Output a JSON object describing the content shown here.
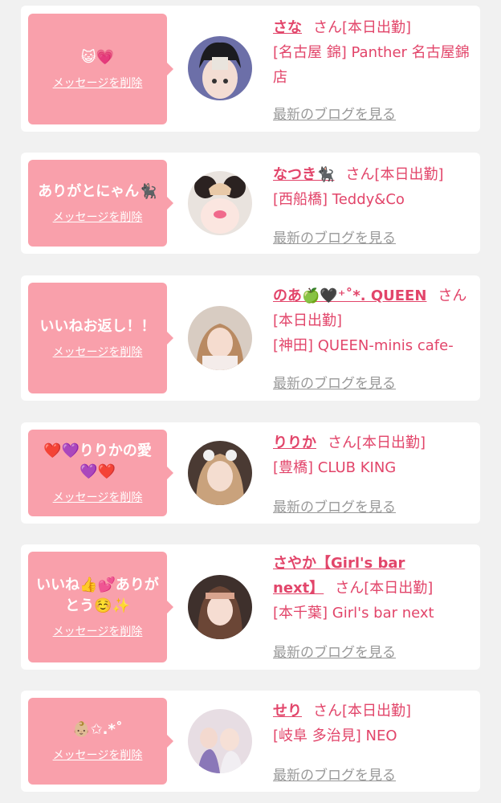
{
  "cards": [
    {
      "message": "😺💗",
      "delete_label": "メッセージを削除",
      "name": "さな",
      "name_cont": "",
      "suffix": "さん[本日出勤]",
      "shop": "[名古屋 錦] Panther 名古屋錦店",
      "blog_label": "最新のブログを見る"
    },
    {
      "message": "ありがとにゃん🐈‍⬛",
      "delete_label": "メッセージを削除",
      "name": "なつき🐈‍⬛",
      "name_cont": "",
      "suffix": "さん[本日出勤]",
      "shop": "[西船橋] Teddy&Co",
      "blog_label": "最新のブログを見る"
    },
    {
      "message": "いいねお返し！！",
      "delete_label": "メッセージを削除",
      "name": "のあ🍏🖤⁺˚*. QUEEN",
      "name_cont": "",
      "suffix": "さん[本日出勤]",
      "shop": "[神田] QUEEN-minis cafe-",
      "blog_label": "最新のブログを見る"
    },
    {
      "message": "❤️💜りりかの愛💜❤️",
      "delete_label": "メッセージを削除",
      "name": "りりか",
      "name_cont": "",
      "suffix": "さん[本日出勤]",
      "shop": "[豊橋] CLUB KING",
      "blog_label": "最新のブログを見る"
    },
    {
      "message": "いいね👍💕ありがとう☺️✨",
      "delete_label": "メッセージを削除",
      "name": "さやか【Girl's bar",
      "name_cont": "next】",
      "suffix": "さん[本日出勤]",
      "shop": "[本千葉] Girl's bar next",
      "blog_label": "最新のブログを見る"
    },
    {
      "message": "👶🏼✩.*˚",
      "delete_label": "メッセージを削除",
      "name": "せり",
      "name_cont": "",
      "suffix": "さん[本日出勤]",
      "shop": "[岐阜 多治見] NEO",
      "blog_label": "最新のブログを見る"
    }
  ],
  "colors": {
    "bubble": "#f9a0ab",
    "accent": "#e2456a",
    "muted": "#999999",
    "background": "#f1f1f1"
  }
}
